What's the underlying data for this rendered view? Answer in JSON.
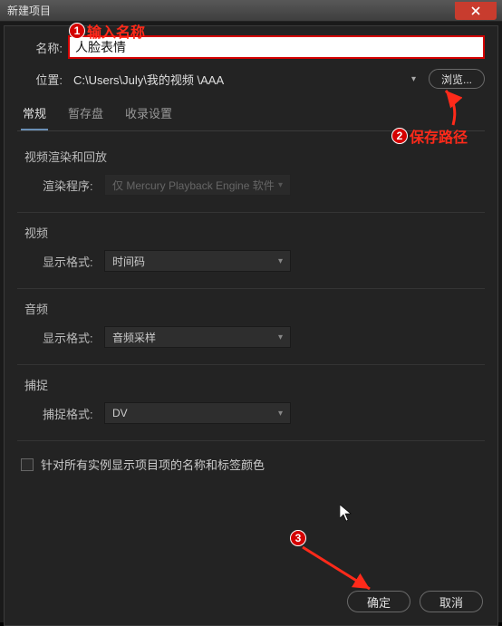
{
  "window": {
    "title": "新建项目"
  },
  "fields": {
    "name_label": "名称:",
    "name_value": "人脸表情",
    "location_label": "位置:",
    "location_value": "C:\\Users\\July\\我的视频 \\AAA",
    "browse_label": "浏览..."
  },
  "tabs": [
    "常规",
    "暂存盘",
    "收录设置"
  ],
  "sections": {
    "render": {
      "title": "视频渲染和回放",
      "label": "渲染程序:",
      "value": "仅 Mercury Playback Engine 软件"
    },
    "video": {
      "title": "视频",
      "label": "显示格式:",
      "value": "时间码"
    },
    "audio": {
      "title": "音频",
      "label": "显示格式:",
      "value": "音频采样"
    },
    "capture": {
      "title": "捕捉",
      "label": "捕捉格式:",
      "value": "DV"
    }
  },
  "checkbox_label": "针对所有实例显示项目项的名称和标签颜色",
  "footer": {
    "ok": "确定",
    "cancel": "取消"
  },
  "annotations": {
    "a1": "输入名称",
    "a2": "保存路径"
  }
}
